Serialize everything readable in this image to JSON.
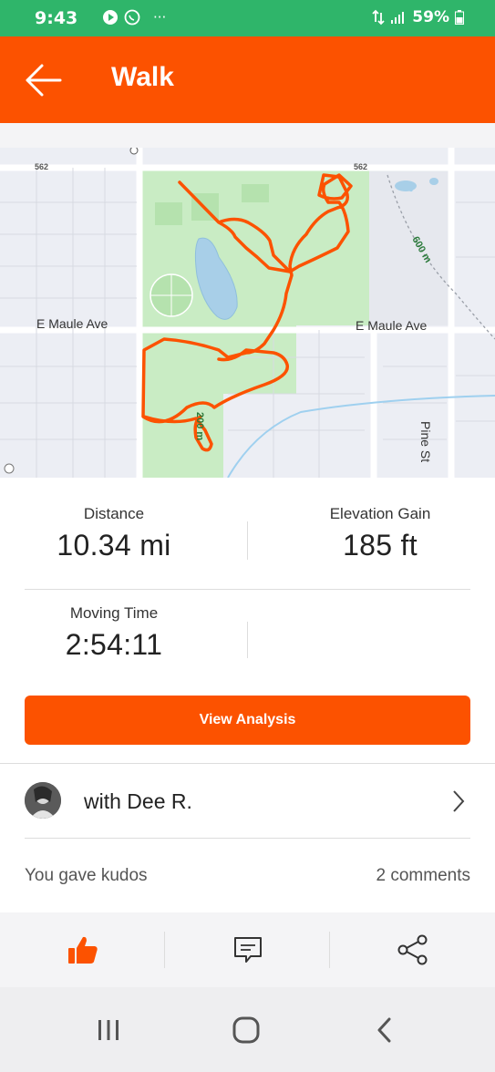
{
  "status_bar": {
    "time": "9:43",
    "battery": "59%",
    "more": "···"
  },
  "app_bar": {
    "title": "Walk",
    "accent_color": "#fc5200"
  },
  "map": {
    "road_labels": {
      "route_562_left": "562",
      "route_562_right": "562",
      "maule_ave_left": "E Maule Ave",
      "maule_ave_right": "E Maule Ave",
      "pine_st": "Pine St",
      "trail_600": "600 m",
      "trail_200": "200 m"
    },
    "route_color": "#fc5200"
  },
  "stats": {
    "distance": {
      "label": "Distance",
      "value": "10.34 mi"
    },
    "elevation": {
      "label": "Elevation Gain",
      "value": "185 ft"
    },
    "moving_time": {
      "label": "Moving Time",
      "value": "2:54:11"
    }
  },
  "cta": {
    "label": "View Analysis"
  },
  "with_row": {
    "label": "with Dee R."
  },
  "social": {
    "kudos": "You gave kudos",
    "comments": "2 comments"
  },
  "actions": {
    "kudos_icon": "thumbs-up-icon",
    "comment_icon": "comment-icon",
    "share_icon": "share-icon"
  }
}
